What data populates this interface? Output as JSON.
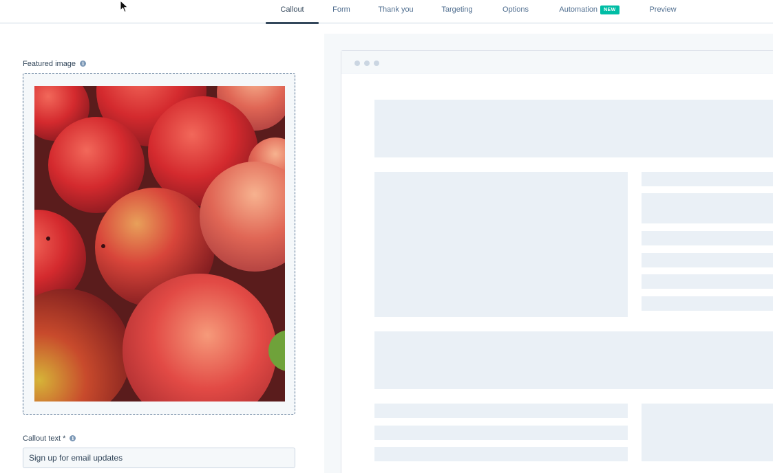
{
  "tabs": [
    {
      "label": "Callout",
      "active": true
    },
    {
      "label": "Form",
      "active": false
    },
    {
      "label": "Thank you",
      "active": false
    },
    {
      "label": "Targeting",
      "active": false
    },
    {
      "label": "Options",
      "active": false
    },
    {
      "label": "Automation",
      "active": false,
      "badge": "NEW"
    },
    {
      "label": "Preview",
      "active": false
    }
  ],
  "editor": {
    "featured_image": {
      "label": "Featured image",
      "info_icon": "info-icon",
      "image_subject": "peaches"
    },
    "callout_text": {
      "label": "Callout text *",
      "info_icon": "info-icon",
      "value": "Sign up for email updates"
    }
  },
  "preview": {
    "window_dots": 3
  },
  "colors": {
    "text": "#33475b",
    "muted": "#516f90",
    "accent_badge": "#00bda5",
    "placeholder": "#eaf0f6",
    "panel_bg": "#f5f8fa"
  }
}
